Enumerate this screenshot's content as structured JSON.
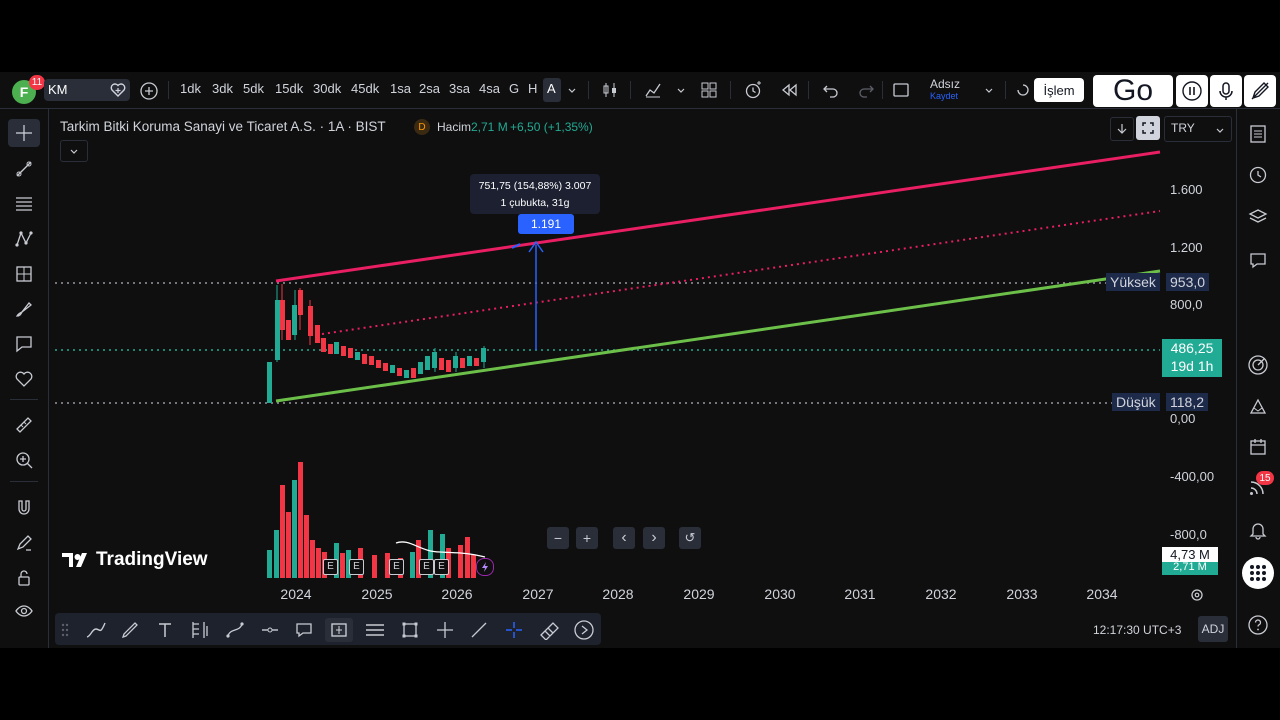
{
  "toolbar": {
    "avatar_letter": "F",
    "avatar_badge": "11",
    "symbol_text": "KM",
    "intervals": [
      "1dk",
      "3dk",
      "5dk",
      "15dk",
      "30dk",
      "45dk",
      "1sa",
      "2sa",
      "3sa",
      "4sa",
      "G",
      "H",
      "A"
    ],
    "active_interval": "A",
    "layout_name": "Adsız",
    "layout_sub": "Kaydet",
    "trade_label": "İşlem",
    "go_label": "Go"
  },
  "legend": {
    "title": "Tarkim Bitki Koruma Sanayi ve Ticaret A.S. · 1A · BIST",
    "d_badge": "D",
    "volume_label": "Hacim",
    "volume_value": "2,71 M",
    "change_text": "+6,50 (+1,35%)"
  },
  "currency": "TRY",
  "measure": {
    "line1": "751,75 (154,88%) 3.007",
    "line2": "1 çubukta, 31g",
    "badge": "1.191"
  },
  "price_axis": {
    "ticks": [
      "1.600",
      "1.200",
      "800,0",
      "0,00",
      "-400,00",
      "-800,0"
    ],
    "high_label": "Yüksek",
    "high_value": "953,0",
    "current_price": "486,25",
    "countdown": "19d 1h",
    "low_label": "Düşük",
    "low_value": "118,2",
    "volume_value": "4,73 M",
    "volume_value_2": "2,71 M"
  },
  "time_axis": {
    "years": [
      "2024",
      "2025",
      "2026",
      "2027",
      "2028",
      "2029",
      "2030",
      "2031",
      "2032",
      "2033",
      "2034"
    ]
  },
  "watermark": "TradingView",
  "zoom_controls": [
    "−",
    "+",
    "‹",
    "›",
    "↺"
  ],
  "events": [
    "E",
    "E",
    "E",
    "E",
    "E"
  ],
  "status": {
    "clock": "12:17:30 UTC+3",
    "adj": "ADJ"
  },
  "alerts_badge": "15",
  "colors": {
    "bg": "#0f0f0f",
    "up": "#22ab94",
    "down": "#f23645",
    "upper_channel": "#e91e63",
    "lower_channel": "#6cc04a",
    "accent": "#2962ff"
  }
}
